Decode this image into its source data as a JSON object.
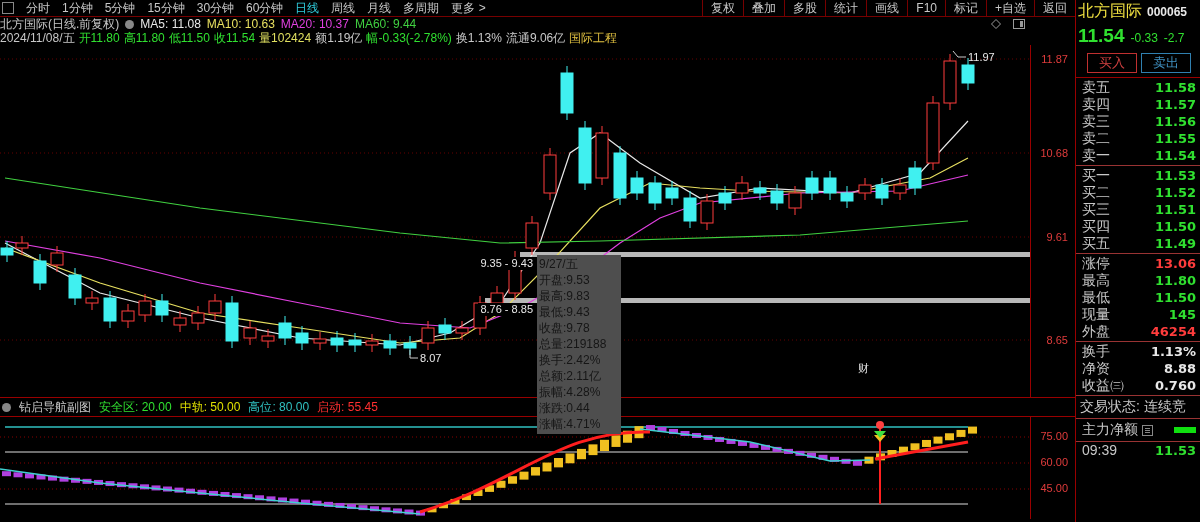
{
  "toolbar": {
    "periods": [
      {
        "label": "分时",
        "selected": false
      },
      {
        "label": "1分钟",
        "selected": false
      },
      {
        "label": "5分钟",
        "selected": false
      },
      {
        "label": "15分钟",
        "selected": false
      },
      {
        "label": "30分钟",
        "selected": false
      },
      {
        "label": "60分钟",
        "selected": false
      },
      {
        "label": "日线",
        "selected": true
      },
      {
        "label": "周线",
        "selected": false
      },
      {
        "label": "月线",
        "selected": false
      },
      {
        "label": "多周期",
        "selected": false
      },
      {
        "label": "更多 >",
        "selected": false
      }
    ],
    "actions": [
      "复权",
      "叠加",
      "多股",
      "统计",
      "画线",
      "F10",
      "标记",
      "+自选",
      "返回"
    ]
  },
  "header": {
    "name": "北方国际(日线.前复权)",
    "ma": [
      {
        "label": "MA5: 11.08",
        "color": "#e8e8e8"
      },
      {
        "label": "MA10: 10.63",
        "color": "#e8e060"
      },
      {
        "label": "MA20: 10.37",
        "color": "#e040e0"
      },
      {
        "label": "MA60: 9.44",
        "color": "#40d040"
      }
    ],
    "quote": [
      {
        "text": "2024/11/08/五",
        "kind": "plain"
      },
      {
        "text": "开11.80",
        "kind": "down"
      },
      {
        "text": "高11.80",
        "kind": "down"
      },
      {
        "text": "低11.50",
        "kind": "down"
      },
      {
        "text": "收11.54",
        "kind": "down"
      },
      {
        "text": "量102424",
        "kind": "volume"
      },
      {
        "text": "额1.19亿",
        "kind": "plain"
      },
      {
        "text": "幅-0.33(-2.78%)",
        "kind": "down"
      },
      {
        "text": "换1.13%",
        "kind": "plain"
      },
      {
        "text": "流通9.06亿",
        "kind": "plain"
      },
      {
        "text": "国际工程",
        "kind": "concept"
      }
    ]
  },
  "main_chart": {
    "y_labels": [
      "11.87",
      "10.68",
      "9.61",
      "8.65"
    ],
    "high_mark": "11.97",
    "low_mark": "8.07",
    "ranges": [
      "9.35 - 9.43",
      "8.76 - 8.85"
    ],
    "event_mark": "财",
    "tooltip": [
      "9/27/五",
      "开盘:9.53",
      "最高:9.83",
      "最低:9.43",
      "收盘:9.78",
      "总量:219188",
      "换手:2.42%",
      "总额:2.11亿",
      "振幅:4.28%",
      "涨跌:0.44",
      "涨幅:4.71%"
    ]
  },
  "indicator": {
    "title": "钻启导航副图",
    "params": [
      {
        "label": "安全区: 20.00",
        "color": "#30e030"
      },
      {
        "label": "中轨: 50.00",
        "color": "#e0e000"
      },
      {
        "label": "高位: 80.00",
        "color": "#30c0c0"
      },
      {
        "label": "启动: 55.45",
        "color": "#ff3030"
      }
    ],
    "y_labels": [
      "75.00",
      "60.00",
      "45.00"
    ]
  },
  "panel": {
    "name": "北方国际",
    "code": "000065",
    "price": "11.54",
    "change": "-0.33",
    "change_pct": "-2.7",
    "buy_button": "买入",
    "sell_button": "卖出",
    "asks": [
      {
        "label": "卖五",
        "value": "11.58"
      },
      {
        "label": "卖四",
        "value": "11.57"
      },
      {
        "label": "卖三",
        "value": "11.56"
      },
      {
        "label": "卖二",
        "value": "11.55"
      },
      {
        "label": "卖一",
        "value": "11.54"
      }
    ],
    "bids": [
      {
        "label": "买一",
        "value": "11.53"
      },
      {
        "label": "买二",
        "value": "11.52"
      },
      {
        "label": "买三",
        "value": "11.51"
      },
      {
        "label": "买四",
        "value": "11.50"
      },
      {
        "label": "买五",
        "value": "11.49"
      }
    ],
    "stats": [
      {
        "label": "涨停",
        "value": "13.06",
        "kind": "up"
      },
      {
        "label": "最高",
        "value": "11.80",
        "kind": "down"
      },
      {
        "label": "最低",
        "value": "11.50",
        "kind": "down"
      },
      {
        "label": "现量",
        "value": "145",
        "kind": "down"
      },
      {
        "label": "外盘",
        "value": "46254",
        "kind": "up"
      }
    ],
    "fundamentals": [
      {
        "label": "换手",
        "value": "1.13%"
      },
      {
        "label": "净资",
        "value": "8.88"
      },
      {
        "label": "收益㈢",
        "value": "0.760"
      }
    ],
    "status": "交易状态: 连续竞",
    "main_flow": "主力净额",
    "tick": {
      "time": "09:39",
      "price": "11.53"
    }
  }
}
